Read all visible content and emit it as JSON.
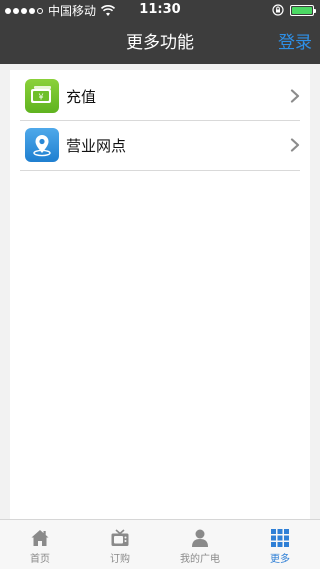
{
  "status_bar": {
    "carrier": "中国移动",
    "time": "11:30"
  },
  "nav": {
    "title": "更多功能",
    "login": "登录"
  },
  "menu": [
    {
      "label": "充值",
      "icon": "recharge-icon"
    },
    {
      "label": "营业网点",
      "icon": "location-pin-icon"
    }
  ],
  "tabs": [
    {
      "label": "首页",
      "icon": "home-icon"
    },
    {
      "label": "订购",
      "icon": "tv-icon"
    },
    {
      "label": "我的广电",
      "icon": "user-icon"
    },
    {
      "label": "更多",
      "icon": "grid-icon",
      "active": true
    }
  ],
  "colors": {
    "header": "#3d3d3d",
    "accent": "#2e8fe6",
    "battery": "#4cd964"
  }
}
